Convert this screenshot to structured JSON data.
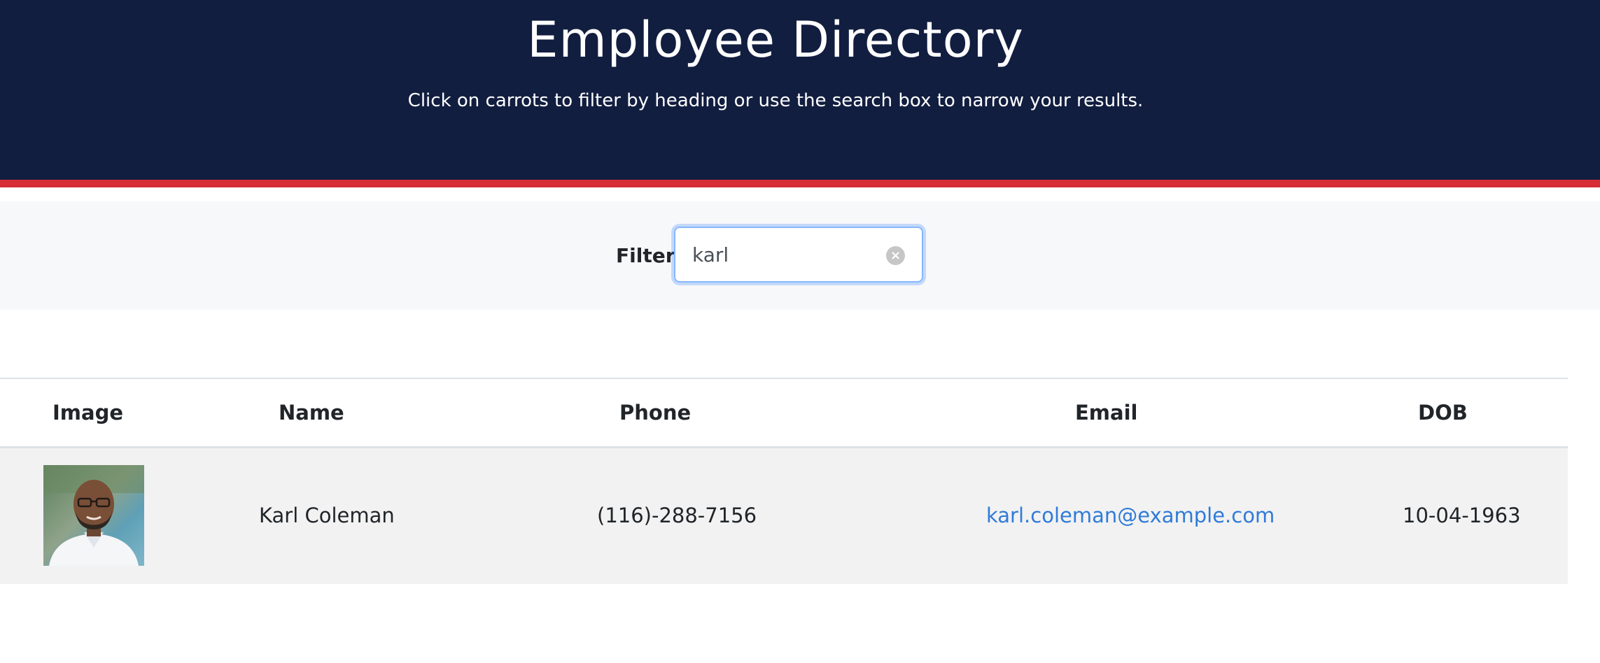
{
  "header": {
    "title": "Employee Directory",
    "subtitle": "Click on carrots to filter by heading or use the search box to narrow your results."
  },
  "filter": {
    "label": "Filter:",
    "value": "karl",
    "clear_icon": "×"
  },
  "table": {
    "columns": [
      "Image",
      "Name",
      "Phone",
      "Email",
      "DOB"
    ],
    "rows": [
      {
        "name": "Karl Coleman",
        "phone": "(116)-288-7156",
        "email": "karl.coleman@example.com",
        "dob": "10-04-1963"
      }
    ]
  },
  "colors": {
    "header_bg": "#121e40",
    "accent_stripe": "#d62d36",
    "link": "#2f7bd9",
    "row_bg": "#f2f2f2"
  }
}
